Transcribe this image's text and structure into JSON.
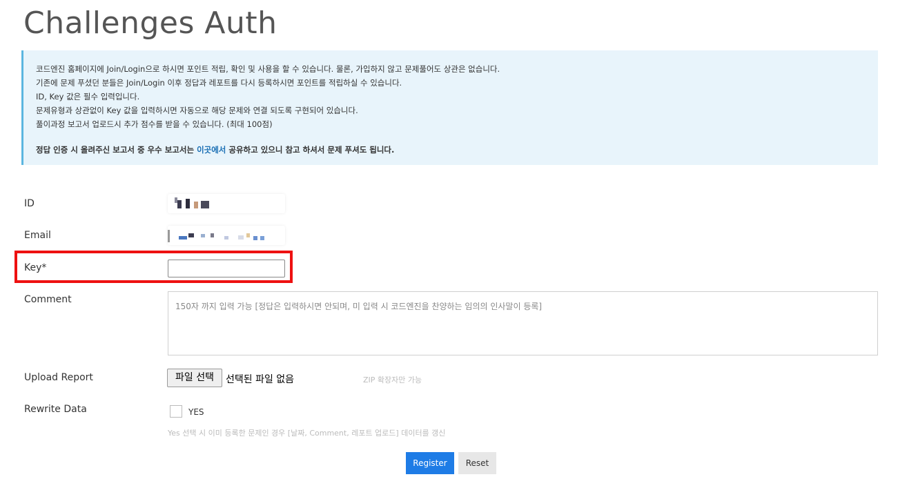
{
  "page": {
    "title": "Challenges Auth"
  },
  "notice": {
    "lines": [
      "코드엔진 홈페이지에 Join/Login으로 하시면 포인트 적립, 확인 및 사용을 할 수 있습니다. 물론, 가입하지 않고 문제풀어도 상관은 없습니다.",
      "기존에 문제 푸셨던 분들은 Join/Login 이후 정답과 레포트를 다시 등록하시면 포인트를 적립하실 수 있습니다.",
      "ID, Key 값은 필수 입력입니다.",
      "문제유형과 상관없이 Key 값을 입력하시면 자동으로 해당 문제와 연결 되도록 구현되어 있습니다.",
      "풀이과정 보고서 업로드시 추가 점수를 받을 수 있습니다. (최대 100점)"
    ],
    "bold_prefix": "정답 인증 시 올려주신 보고서 중 우수 보고서는 ",
    "bold_link": "이곳에서",
    "bold_suffix": " 공유하고 있으니 참고 하셔서 문제 푸셔도 됩니다."
  },
  "form": {
    "id_label": "ID",
    "email_label": "Email",
    "key_label": "Key*",
    "key_value": "",
    "comment_label": "Comment",
    "comment_placeholder": "150자 까지 입력 가능 [정답은 입력하시면 안되며, 미 입력 시 코드엔진을 찬양하는 임의의 인사말이 등록]",
    "upload_label": "Upload Report",
    "file_button": "파일 선택",
    "file_status": "선택된 파일 없음",
    "zip_hint": "ZIP 확장자만 가능",
    "rewrite_label": "Rewrite Data",
    "rewrite_option": "YES",
    "rewrite_checked": false,
    "rewrite_hint": "Yes 선택 시 이미 등록한 문제인 경우 [날짜, Comment, 레포트 업로드] 데이터를 갱신"
  },
  "actions": {
    "register": "Register",
    "reset": "Reset"
  },
  "colors": {
    "accent": "#1e7ce6",
    "highlight": "#ee1111",
    "notice_bg": "#e8f4fb",
    "notice_border": "#5bb6e0"
  }
}
